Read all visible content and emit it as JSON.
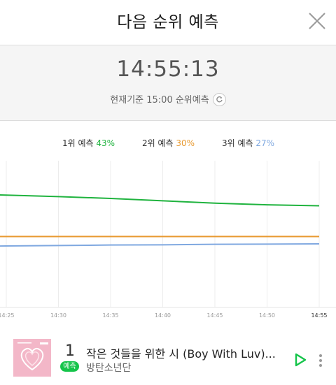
{
  "header": {
    "title": "다음 순위 예측",
    "close_icon": "close-icon"
  },
  "timer": {
    "clock": "14:55:13",
    "basis_text": "현재기준 15:00 순위예측",
    "refresh_icon": "refresh-icon"
  },
  "legend": [
    {
      "label": "1위 예측",
      "value": "43%",
      "color": "#1fb33e"
    },
    {
      "label": "2위 예측",
      "value": "30%",
      "color": "#e89a31"
    },
    {
      "label": "3위 예측",
      "value": "27%",
      "color": "#7fa8e0"
    }
  ],
  "chart_data": {
    "type": "line",
    "x": [
      "14:25",
      "14:30",
      "14:35",
      "14:40",
      "14:45",
      "14:50",
      "14:55"
    ],
    "series": [
      {
        "name": "1위 예측",
        "color": "#1fb33e",
        "values": [
          47.5,
          46.9,
          46.1,
          45.1,
          44.1,
          43.4,
          43.0
        ]
      },
      {
        "name": "2위 예측",
        "color": "#e89a31",
        "values": [
          30.0,
          30.0,
          30.0,
          30.0,
          30.0,
          30.0,
          30.0
        ]
      },
      {
        "name": "3위 예측",
        "color": "#7fa8e0",
        "values": [
          26.0,
          26.2,
          26.4,
          26.5,
          26.7,
          26.8,
          26.9
        ]
      }
    ],
    "ylim": [
      0,
      60
    ],
    "grid": "vertical"
  },
  "song": {
    "rank": "1",
    "badge": "예측",
    "title": "작은 것들을 위한 시 (Boy With Luv)...",
    "artist": "방탄소년단",
    "album_art": "album-art",
    "play_icon": "play-icon",
    "more_icon": "more-icon"
  }
}
